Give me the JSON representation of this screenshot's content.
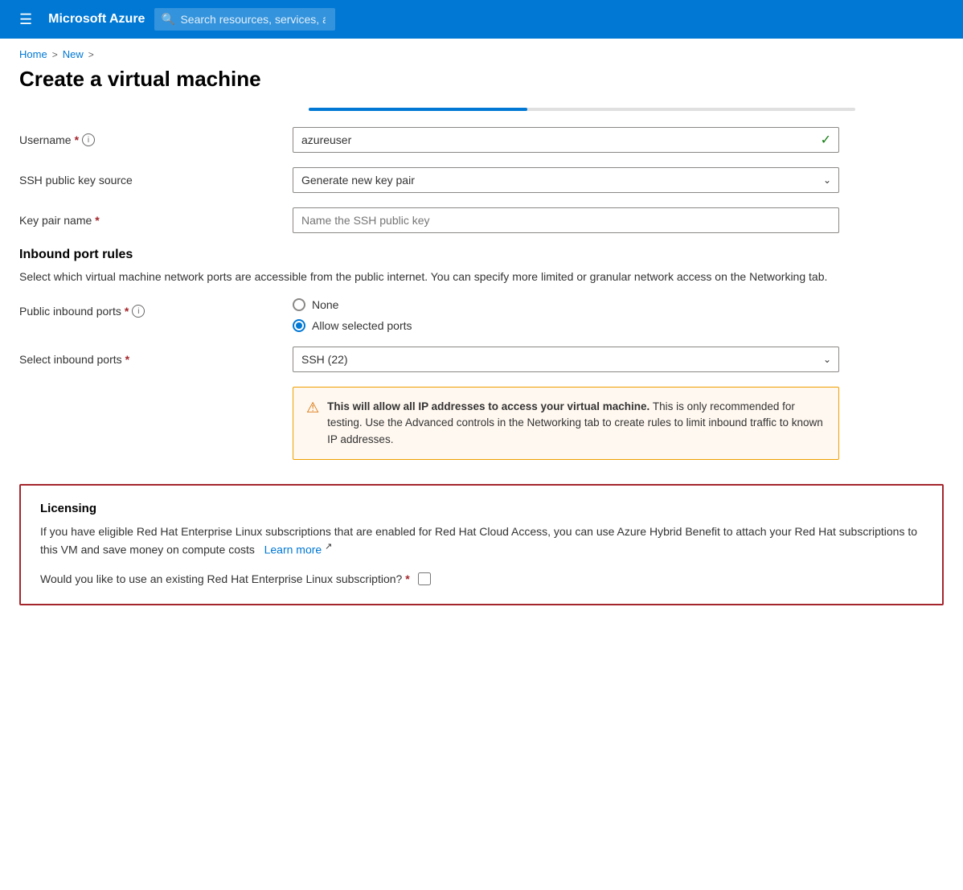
{
  "topnav": {
    "brand": "Microsoft Azure",
    "search_placeholder": "Search resources, services, and docs (G+/)"
  },
  "breadcrumb": {
    "home": "Home",
    "new": "New",
    "sep1": ">",
    "sep2": ">"
  },
  "page": {
    "title": "Create a virtual machine"
  },
  "form": {
    "username_label": "Username",
    "username_value": "azureuser",
    "ssh_key_source_label": "SSH public key source",
    "ssh_key_source_value": "Generate new key pair",
    "key_pair_name_label": "Key pair name",
    "key_pair_name_placeholder": "Name the SSH public key",
    "inbound_rules_heading": "Inbound port rules",
    "inbound_rules_desc": "Select which virtual machine network ports are accessible from the public internet. You can specify more limited or granular network access on the Networking tab.",
    "public_inbound_label": "Public inbound ports",
    "radio_none": "None",
    "radio_allow": "Allow selected ports",
    "select_inbound_label": "Select inbound ports",
    "select_inbound_value": "SSH (22)"
  },
  "warning": {
    "bold_text": "This will allow all IP addresses to access your virtual machine.",
    "rest_text": "  This is only recommended for testing.  Use the Advanced controls in the Networking tab to create rules to limit inbound traffic to known IP addresses."
  },
  "licensing": {
    "title": "Licensing",
    "desc_text": "If you have eligible Red Hat Enterprise Linux subscriptions that are enabled for Red Hat Cloud Access, you can use Azure Hybrid Benefit to attach your Red Hat subscriptions to this VM and save money on compute costs",
    "learn_more": "Learn more",
    "question_text": "Would you like to use an existing Red Hat Enterprise Linux subscription?"
  }
}
